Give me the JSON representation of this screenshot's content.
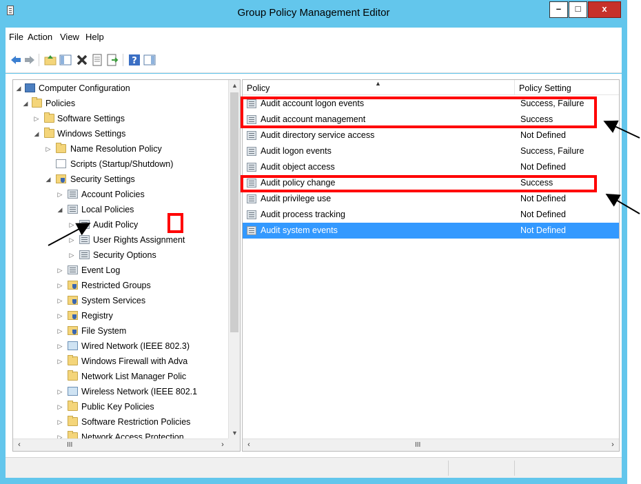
{
  "window": {
    "title": "Group Policy Management Editor",
    "minimize": "–",
    "maximize": "□",
    "close": "x"
  },
  "menu": [
    "File",
    "Action",
    "View",
    "Help"
  ],
  "tree": {
    "computer_configuration": "Computer Configuration",
    "policies": "Policies",
    "software_settings": "Software Settings",
    "windows_settings": "Windows Settings",
    "name_resolution_policy": "Name Resolution Policy",
    "scripts": "Scripts (Startup/Shutdown)",
    "security_settings": "Security Settings",
    "account_policies": "Account Policies",
    "local_policies": "Local Policies",
    "audit_policy": "Audit Policy",
    "user_rights_assignment": "User Rights Assignment",
    "security_options": "Security Options",
    "event_log": "Event Log",
    "restricted_groups": "Restricted Groups",
    "system_services": "System Services",
    "registry": "Registry",
    "file_system": "File System",
    "wired_network": "Wired Network (IEEE 802.3)",
    "windows_firewall": "Windows Firewall with Adva",
    "network_list_manager": "Network List Manager Polic",
    "wireless_network": "Wireless Network (IEEE 802.1",
    "public_key_policies": "Public Key Policies",
    "software_restriction": "Software Restriction Policies",
    "network_access_protection": "Network Access Protection"
  },
  "list": {
    "columns": [
      "Policy",
      "Policy Setting"
    ],
    "rows": [
      {
        "policy": "Audit account logon events",
        "setting": "Success, Failure"
      },
      {
        "policy": "Audit account management",
        "setting": "Success"
      },
      {
        "policy": "Audit directory service access",
        "setting": "Not Defined"
      },
      {
        "policy": "Audit logon events",
        "setting": "Success, Failure"
      },
      {
        "policy": "Audit object access",
        "setting": "Not Defined"
      },
      {
        "policy": "Audit policy change",
        "setting": "Success"
      },
      {
        "policy": "Audit privilege use",
        "setting": "Not Defined"
      },
      {
        "policy": "Audit process tracking",
        "setting": "Not Defined"
      },
      {
        "policy": "Audit system events",
        "setting": "Not Defined"
      }
    ],
    "selected_row": "Audit system events"
  },
  "scroll_glyph": "III",
  "colors": {
    "titlebar": "#63c6ec",
    "selection": "#3399ff",
    "annotation": "#ff0000"
  }
}
